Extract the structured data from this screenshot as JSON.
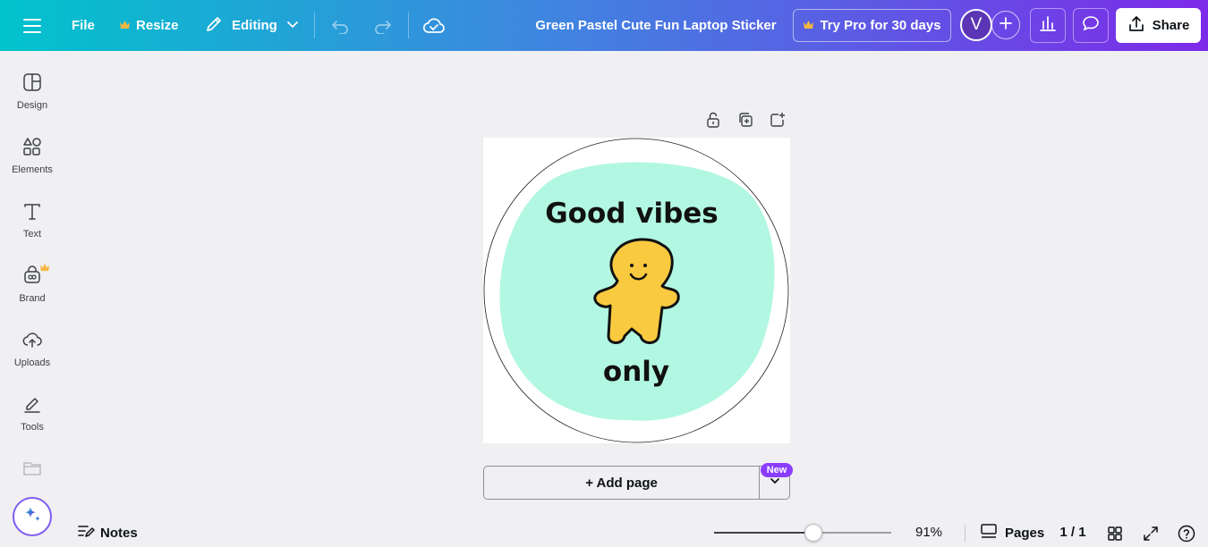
{
  "topbar": {
    "file_label": "File",
    "resize_label": "Resize",
    "editing_label": "Editing",
    "document_title": "Green Pastel Cute Fun Laptop Sticker",
    "pro_label": "Try Pro for 30 days",
    "avatar_initial": "V",
    "share_label": "Share"
  },
  "sidebar": {
    "items": [
      {
        "label": "Design",
        "icon": "design-icon"
      },
      {
        "label": "Elements",
        "icon": "elements-icon"
      },
      {
        "label": "Text",
        "icon": "text-icon"
      },
      {
        "label": "Brand",
        "icon": "brand-icon"
      },
      {
        "label": "Uploads",
        "icon": "uploads-icon"
      },
      {
        "label": "Tools",
        "icon": "tools-icon"
      }
    ]
  },
  "canvas": {
    "sticker_text_top": "Good vibes",
    "sticker_text_bottom": "only",
    "add_page_label": "+ Add page",
    "new_badge": "New"
  },
  "bottombar": {
    "notes_label": "Notes",
    "zoom_value": "91%",
    "zoom_fraction": 0.56,
    "pages_label": "Pages",
    "page_count": "1 / 1"
  },
  "colors": {
    "gradient_start": "#01c3cc",
    "gradient_end": "#7d2ae8",
    "sticker_blob": "#b2f7e2",
    "character_yellow": "#f9ca3f",
    "new_badge": "#8b3dff"
  }
}
